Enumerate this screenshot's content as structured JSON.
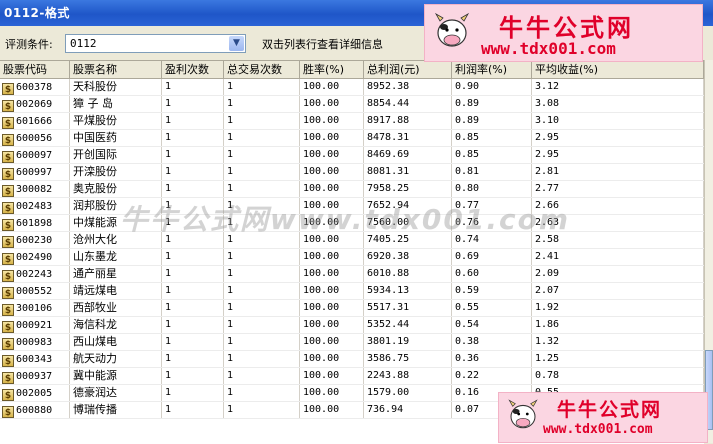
{
  "window": {
    "title": "0112-格式"
  },
  "toolbar": {
    "condition_label": "评测条件:",
    "condition_value": "0112",
    "hint": "双击列表行查看详细信息"
  },
  "columns": [
    "股票代码",
    "股票名称",
    "盈利次数",
    "总交易次数",
    "胜率(%)",
    "总利润(元)",
    "利润率(%)",
    "平均收益(%)"
  ],
  "rows": [
    [
      "600378",
      "天科股份",
      "1",
      "1",
      "100.00",
      "8952.38",
      "0.90",
      "3.12"
    ],
    [
      "002069",
      "獐 子 岛",
      "1",
      "1",
      "100.00",
      "8854.44",
      "0.89",
      "3.08"
    ],
    [
      "601666",
      "平煤股份",
      "1",
      "1",
      "100.00",
      "8917.88",
      "0.89",
      "3.10"
    ],
    [
      "600056",
      "中国医药",
      "1",
      "1",
      "100.00",
      "8478.31",
      "0.85",
      "2.95"
    ],
    [
      "600097",
      "开创国际",
      "1",
      "1",
      "100.00",
      "8469.69",
      "0.85",
      "2.95"
    ],
    [
      "600997",
      "开滦股份",
      "1",
      "1",
      "100.00",
      "8081.31",
      "0.81",
      "2.81"
    ],
    [
      "300082",
      "奥克股份",
      "1",
      "1",
      "100.00",
      "7958.25",
      "0.80",
      "2.77"
    ],
    [
      "002483",
      "润邦股份",
      "1",
      "1",
      "100.00",
      "7652.94",
      "0.77",
      "2.66"
    ],
    [
      "601898",
      "中煤能源",
      "1",
      "1",
      "100.00",
      "7560.00",
      "0.76",
      "2.63"
    ],
    [
      "600230",
      "沧州大化",
      "1",
      "1",
      "100.00",
      "7405.25",
      "0.74",
      "2.58"
    ],
    [
      "002490",
      "山东墨龙",
      "1",
      "1",
      "100.00",
      "6920.38",
      "0.69",
      "2.41"
    ],
    [
      "002243",
      "通产丽星",
      "1",
      "1",
      "100.00",
      "6010.88",
      "0.60",
      "2.09"
    ],
    [
      "000552",
      "靖远煤电",
      "1",
      "1",
      "100.00",
      "5934.13",
      "0.59",
      "2.07"
    ],
    [
      "300106",
      "西部牧业",
      "1",
      "1",
      "100.00",
      "5517.31",
      "0.55",
      "1.92"
    ],
    [
      "000921",
      "海信科龙",
      "1",
      "1",
      "100.00",
      "5352.44",
      "0.54",
      "1.86"
    ],
    [
      "000983",
      "西山煤电",
      "1",
      "1",
      "100.00",
      "3801.19",
      "0.38",
      "1.32"
    ],
    [
      "600343",
      "航天动力",
      "1",
      "1",
      "100.00",
      "3586.75",
      "0.36",
      "1.25"
    ],
    [
      "000937",
      "冀中能源",
      "1",
      "1",
      "100.00",
      "2243.88",
      "0.22",
      "0.78"
    ],
    [
      "002005",
      "德豪润达",
      "1",
      "1",
      "100.00",
      "1579.00",
      "0.16",
      "0.55"
    ],
    [
      "600880",
      "博瑞传播",
      "1",
      "1",
      "100.00",
      "736.94",
      "0.07",
      "0.26"
    ]
  ],
  "watermark": {
    "brand": "牛牛公式网",
    "url": "www.tdx001.com",
    "overlay": "牛牛公式网www.tdx001.com"
  },
  "icons": {
    "row_icon": "stock-dollar-icon",
    "dropdown": "chevron-down-icon"
  },
  "colors": {
    "titlebar": "#2a63d6",
    "brand_red": "#e0002a",
    "logo_bg": "#fbd6e2"
  }
}
